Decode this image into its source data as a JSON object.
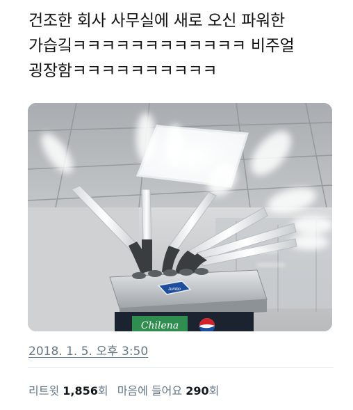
{
  "tweet": {
    "lines": [
      "건조한 회사 사무실에 새로 오신 파워한",
      "가습깈ㅋㅋㅋㅋㅋㅋㅋㅋㅋㅋㅋㅋ 비주얼",
      "굉장함ㅋㅋㅋㅋㅋㅋㅋㅋㅋㅋ"
    ],
    "timestamp": "2018. 1. 5. 오후 3:50"
  },
  "image": {
    "humidifier_badge": "Jumbo",
    "cooler_brand": "Chilena"
  },
  "stats": {
    "retweets_label": "리트윗",
    "retweets_count": "1,856",
    "retweets_unit": "회",
    "likes_label": "마음에 들어요",
    "likes_count": "290",
    "likes_unit": "회"
  }
}
